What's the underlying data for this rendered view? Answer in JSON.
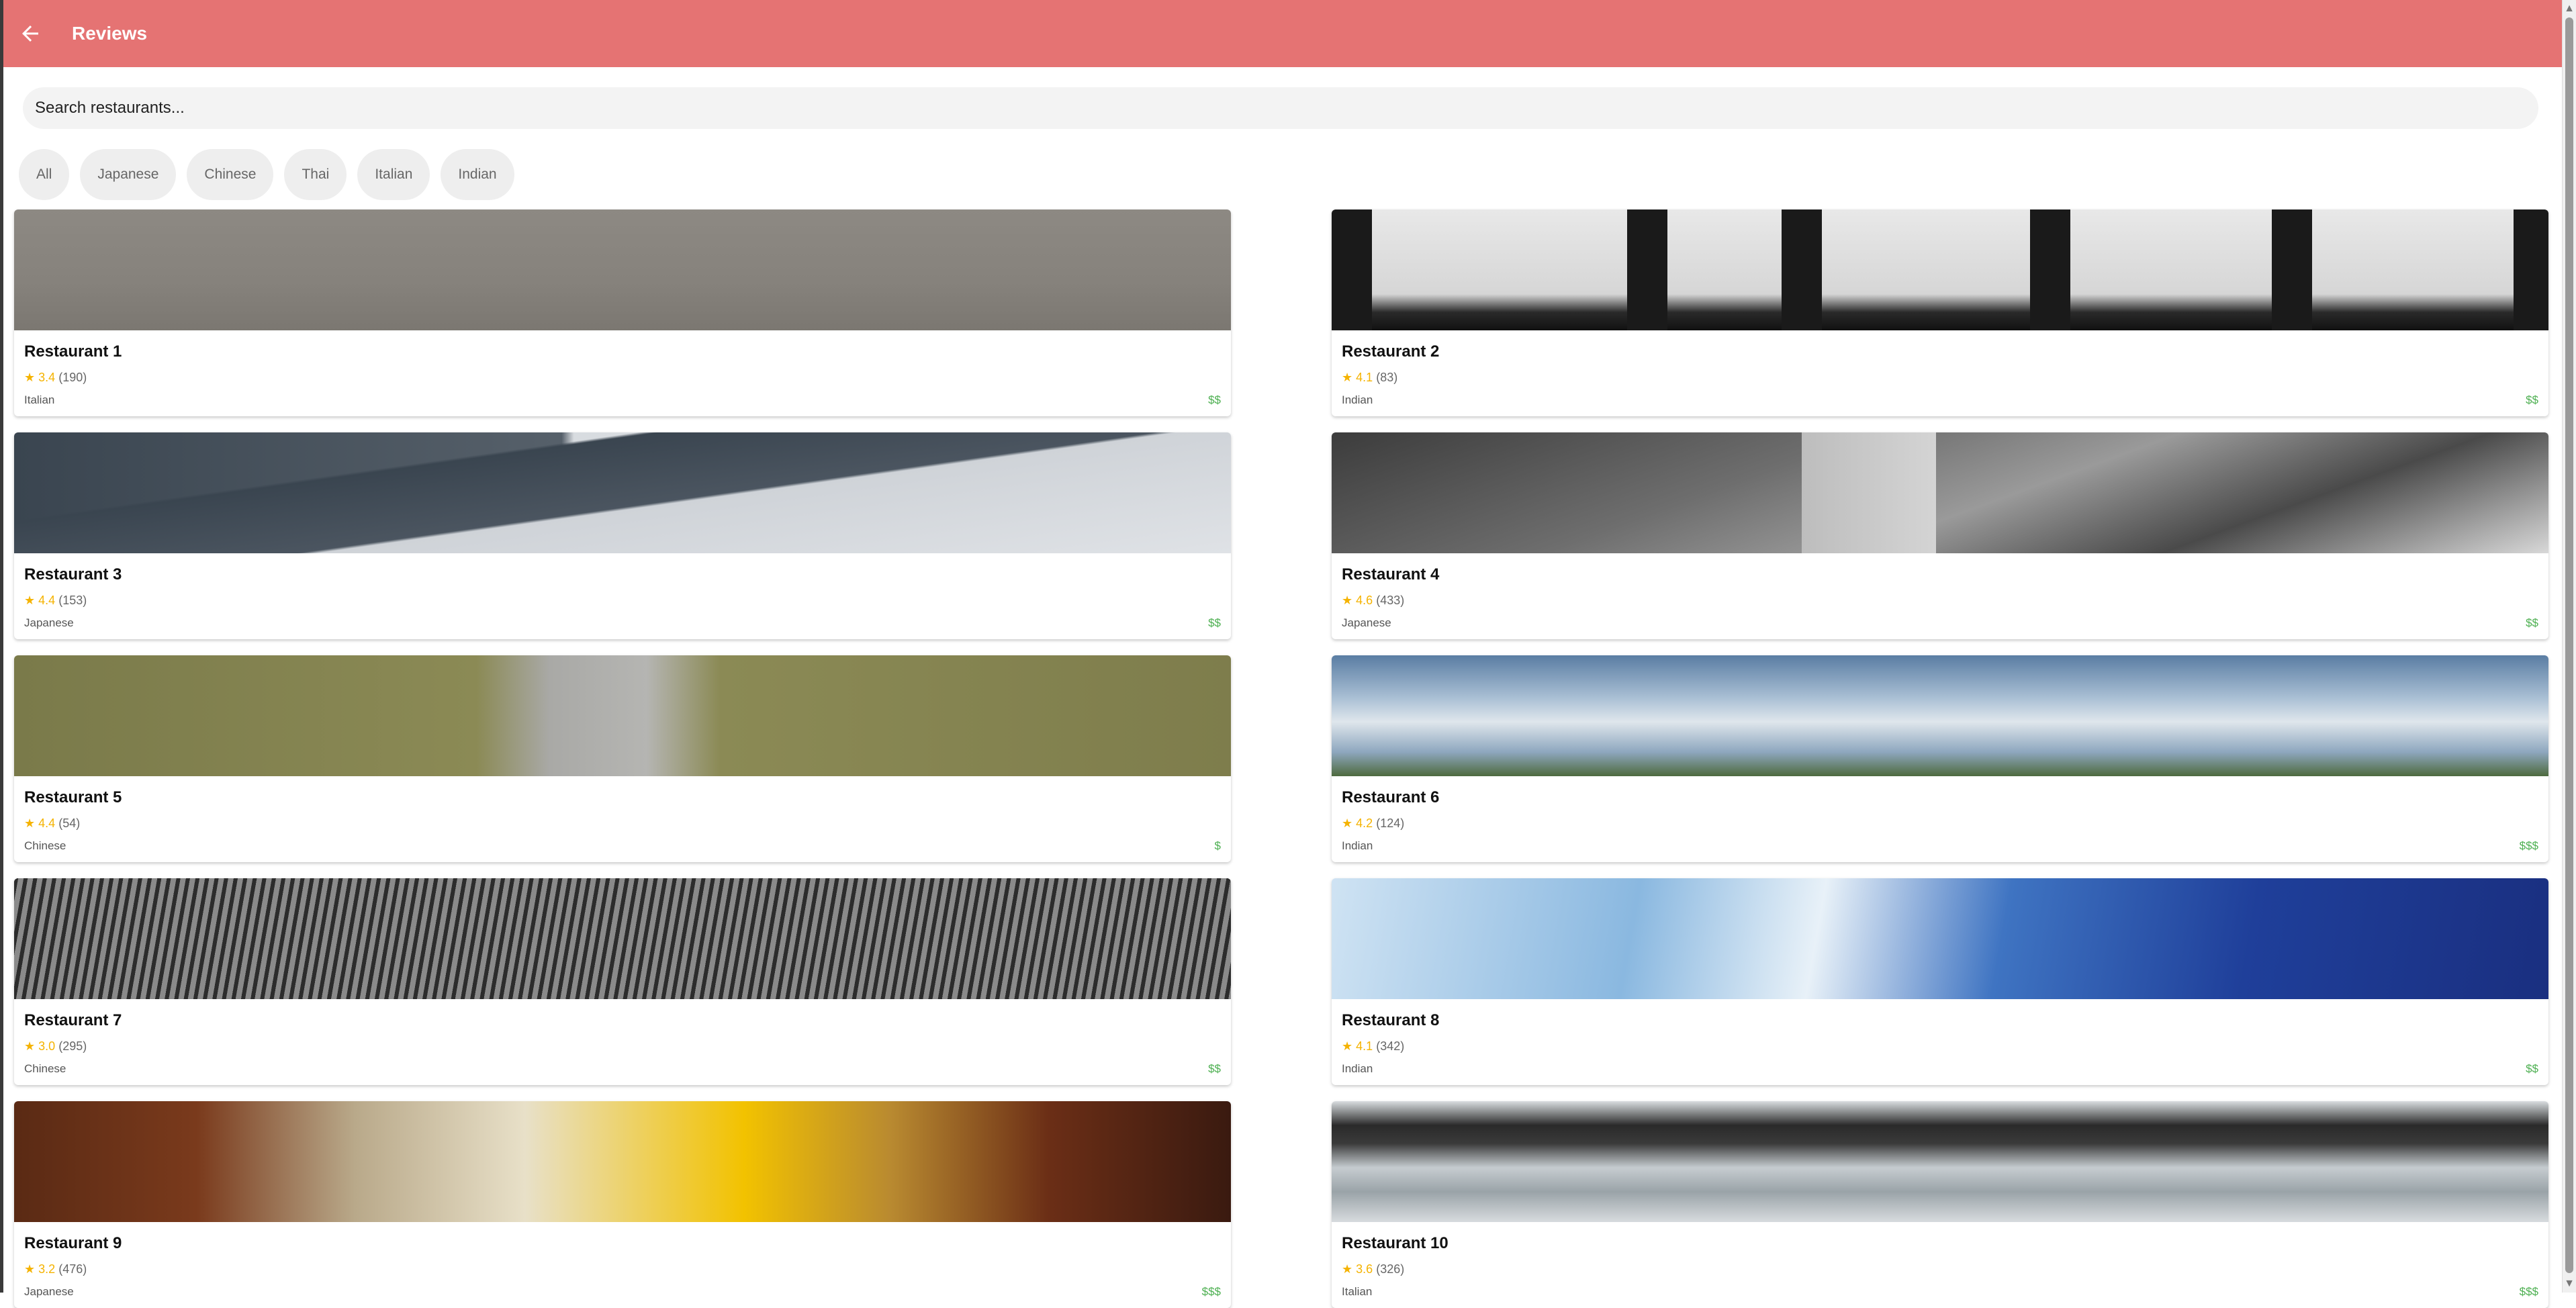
{
  "appbar": {
    "title": "Reviews",
    "back_icon": "arrow-left-icon",
    "color": "#e57373"
  },
  "search": {
    "placeholder": "Search restaurants..."
  },
  "filters": [
    "All",
    "Japanese",
    "Chinese",
    "Thai",
    "Italian",
    "Indian"
  ],
  "restaurants": [
    {
      "name": "Restaurant 1",
      "rating": "3.4",
      "reviews": "(190)",
      "cuisine": "Italian",
      "price": "$$"
    },
    {
      "name": "Restaurant 2",
      "rating": "4.1",
      "reviews": "(83)",
      "cuisine": "Indian",
      "price": "$$"
    },
    {
      "name": "Restaurant 3",
      "rating": "4.4",
      "reviews": "(153)",
      "cuisine": "Japanese",
      "price": "$$"
    },
    {
      "name": "Restaurant 4",
      "rating": "4.6",
      "reviews": "(433)",
      "cuisine": "Japanese",
      "price": "$$"
    },
    {
      "name": "Restaurant 5",
      "rating": "4.4",
      "reviews": "(54)",
      "cuisine": "Chinese",
      "price": "$"
    },
    {
      "name": "Restaurant 6",
      "rating": "4.2",
      "reviews": "(124)",
      "cuisine": "Indian",
      "price": "$$$"
    },
    {
      "name": "Restaurant 7",
      "rating": "3.0",
      "reviews": "(295)",
      "cuisine": "Chinese",
      "price": "$$"
    },
    {
      "name": "Restaurant 8",
      "rating": "4.1",
      "reviews": "(342)",
      "cuisine": "Indian",
      "price": "$$"
    },
    {
      "name": "Restaurant 9",
      "rating": "3.2",
      "reviews": "(476)",
      "cuisine": "Japanese",
      "price": "$$$"
    },
    {
      "name": "Restaurant 10",
      "rating": "3.6",
      "reviews": "(326)",
      "cuisine": "Italian",
      "price": "$$$"
    }
  ],
  "colors": {
    "star": "#f5b301",
    "price": "#4caf50"
  }
}
